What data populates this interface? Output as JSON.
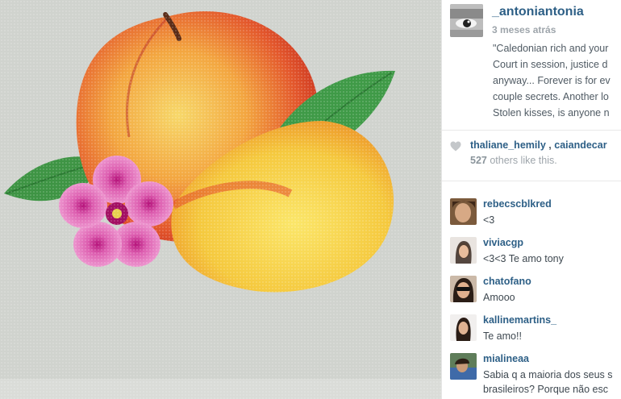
{
  "post": {
    "owner": "_antoniantonia",
    "time": "3 meses atrás",
    "caption_lines": [
      "\"Caledonian rich and your",
      "Court in session, justice d",
      "anyway... Forever is for ev",
      "couple secrets. Another lo",
      "Stolen kisses, is anyone n"
    ]
  },
  "likes": {
    "names": [
      "thaliane_hemily",
      "caiandecar"
    ],
    "separator": ",",
    "count": "527",
    "others_text": "others like this."
  },
  "comments": [
    {
      "user": "rebecscblkred",
      "text": "<3"
    },
    {
      "user": "viviacgp",
      "text": "<3<3 Te amo tony"
    },
    {
      "user": "chatofano",
      "text": "Amooo"
    },
    {
      "user": "kallinemartins_",
      "text": "Te amo!!"
    },
    {
      "user": "mialineaa",
      "lines": [
        "Sabia q a maioria dos seus s",
        "brasileiros? Porque não esc"
      ]
    }
  ],
  "icons": {
    "heart": "heart-icon",
    "avatar": "avatar"
  },
  "colors": {
    "link": "#2d5f86",
    "muted": "#9ea5ab",
    "photo_bg": "#cfd2cd"
  }
}
